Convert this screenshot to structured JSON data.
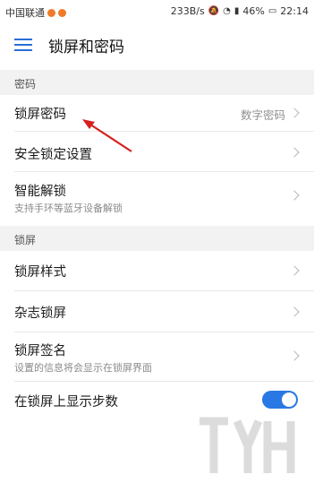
{
  "status_bar": {
    "carrier": "中国联通",
    "net_speed": "233B/s",
    "battery": "46%",
    "time": "22:14",
    "accent_color": "#f07a2a"
  },
  "header": {
    "title": "锁屏和密码",
    "menu_icon": "hamburger-icon"
  },
  "sections": {
    "password": {
      "header": "密码",
      "items": [
        {
          "label": "锁屏密码",
          "value": "数字密码"
        },
        {
          "label": "安全锁定设置"
        },
        {
          "label": "智能解锁",
          "sub": "支持手环等蓝牙设备解锁"
        }
      ]
    },
    "lockscreen": {
      "header": "锁屏",
      "items": [
        {
          "label": "锁屏样式"
        },
        {
          "label": "杂志锁屏"
        },
        {
          "label": "锁屏签名",
          "sub": "设置的信息将会显示在锁屏界面"
        },
        {
          "label": "在锁屏上显示步数",
          "toggle_on": true
        }
      ]
    }
  },
  "colors": {
    "toggle_on": "#2a78e4",
    "arrow": "#d62020",
    "section_bg": "#f2f2f2"
  }
}
